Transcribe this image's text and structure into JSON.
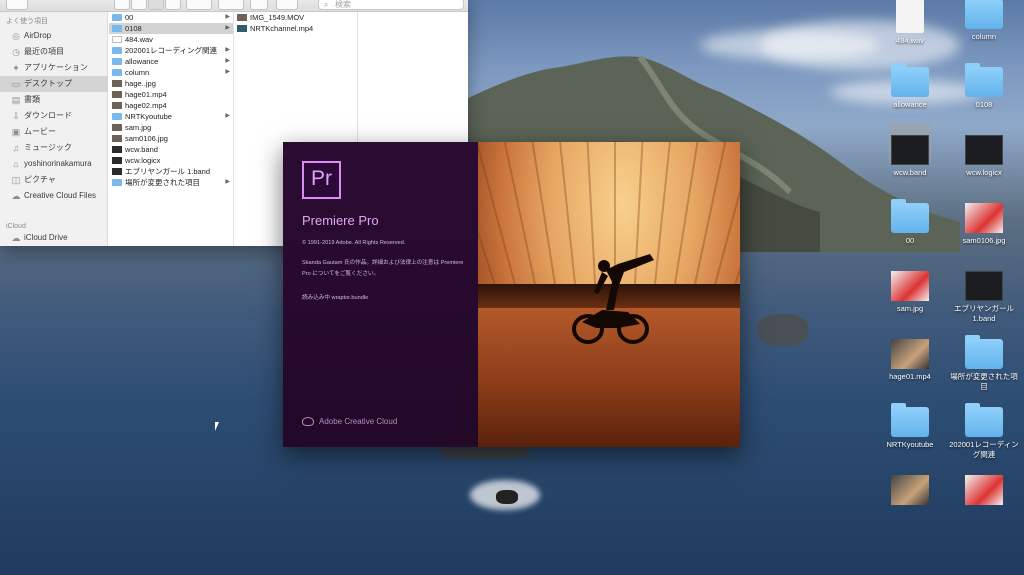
{
  "finder": {
    "search_placeholder": "検索",
    "sidebar": {
      "favorites_header": "よく使う項目",
      "icloud_header": "iCloud",
      "items": [
        {
          "label": "AirDrop",
          "icon": "airdrop-icon",
          "glyph": "◎"
        },
        {
          "label": "最近の項目",
          "icon": "clock-icon",
          "glyph": "◷"
        },
        {
          "label": "アプリケーション",
          "icon": "applications-icon",
          "glyph": "✦"
        },
        {
          "label": "デスクトップ",
          "icon": "desktop-icon",
          "glyph": "▭"
        },
        {
          "label": "書類",
          "icon": "documents-icon",
          "glyph": "▤"
        },
        {
          "label": "ダウンロード",
          "icon": "download-icon",
          "glyph": "⇩"
        },
        {
          "label": "ムービー",
          "icon": "movies-icon",
          "glyph": "▣"
        },
        {
          "label": "ミュージック",
          "icon": "music-icon",
          "glyph": "♫"
        },
        {
          "label": "yoshinorinakamura",
          "icon": "home-icon",
          "glyph": "⌂"
        },
        {
          "label": "ピクチャ",
          "icon": "pictures-icon",
          "glyph": "◫"
        },
        {
          "label": "Creative Cloud Files",
          "icon": "creative-cloud-icon",
          "glyph": "☁"
        }
      ],
      "icloud_items": [
        {
          "label": "iCloud Drive",
          "icon": "icloud-icon",
          "glyph": "☁"
        }
      ]
    },
    "column1": [
      {
        "name": "00",
        "kind": "folder",
        "arrow": true
      },
      {
        "name": "0108",
        "kind": "folder",
        "arrow": true
      },
      {
        "name": "484.wav",
        "kind": "file",
        "arrow": false
      },
      {
        "name": "202001レコーディング関連",
        "kind": "folder",
        "arrow": true
      },
      {
        "name": "allowance",
        "kind": "folder",
        "arrow": true
      },
      {
        "name": "column",
        "kind": "folder",
        "arrow": true
      },
      {
        "name": "hage..jpg",
        "kind": "img",
        "arrow": false
      },
      {
        "name": "hage01.mp4",
        "kind": "img",
        "arrow": false
      },
      {
        "name": "hage02.mp4",
        "kind": "img",
        "arrow": false
      },
      {
        "name": "NRTKyoutube",
        "kind": "folder",
        "arrow": true
      },
      {
        "name": "sam.jpg",
        "kind": "img",
        "arrow": false
      },
      {
        "name": "sam0106.jpg",
        "kind": "img",
        "arrow": false
      },
      {
        "name": "wcw.band",
        "kind": "band",
        "arrow": false
      },
      {
        "name": "wcw.logicx",
        "kind": "band",
        "arrow": false
      },
      {
        "name": "エブリヤンガール 1.band",
        "kind": "band",
        "arrow": false
      },
      {
        "name": "場所が変更された項目",
        "kind": "folder",
        "arrow": true
      }
    ],
    "column2": [
      {
        "name": "IMG_1549.MOV",
        "kind": "img"
      },
      {
        "name": "NRTKchannel.mp4",
        "kind": "vid"
      }
    ]
  },
  "splash": {
    "logo": "Pr",
    "title": "Premiere Pro",
    "copyright": "© 1991-2019 Adobe. All Rights Reserved.",
    "credit": "Skanda Gautam 氏の作品。詳細および法律上の注意は Premiere Pro についてをご覧ください。",
    "loading": "読み込み中 wraptor.bundle",
    "brand": "Adobe Creative Cloud"
  },
  "desktop": {
    "icons": [
      {
        "label": "484.wav",
        "type": "doc"
      },
      {
        "label": "column",
        "type": "folder"
      },
      {
        "label": "allowance",
        "type": "folder"
      },
      {
        "label": "0108",
        "type": "folder"
      },
      {
        "label": "wcw.band",
        "type": "dark"
      },
      {
        "label": "wcw.logicx",
        "type": "dark"
      },
      {
        "label": "00",
        "type": "folder"
      },
      {
        "label": "sam0106.jpg",
        "type": "photo"
      },
      {
        "label": "sam.jpg",
        "type": "photo"
      },
      {
        "label": "エブリヤンガール 1.band",
        "type": "dark"
      },
      {
        "label": "hage01.mp4",
        "type": "video"
      },
      {
        "label": "場所が変更された項目",
        "type": "folder"
      },
      {
        "label": "NRTKyoutube",
        "type": "folder"
      },
      {
        "label": "202001レコーディング関連",
        "type": "folder"
      },
      {
        "label": "",
        "type": "video"
      },
      {
        "label": "",
        "type": "photo"
      }
    ]
  }
}
